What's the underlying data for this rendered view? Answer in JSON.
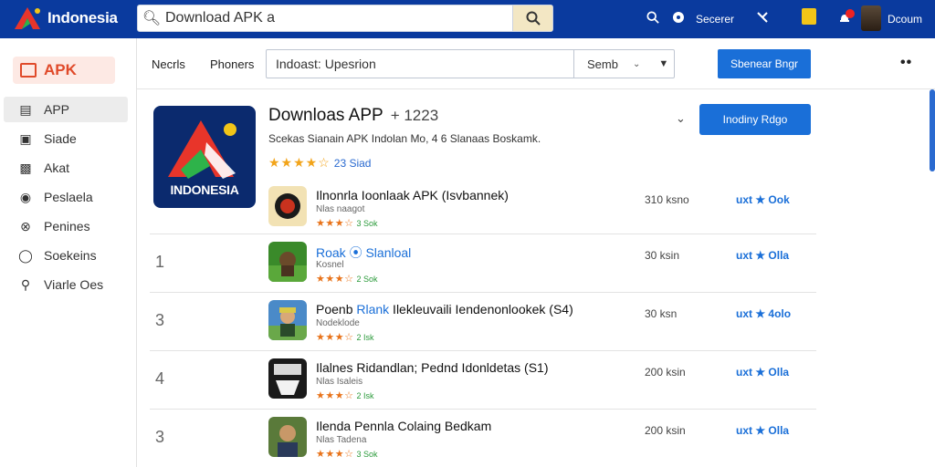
{
  "header": {
    "brand": "Indonesia",
    "search_value": "Download APK a",
    "account_label": "Secerer",
    "user_label": "Dcoum"
  },
  "sidebar": {
    "apk_label": "APK",
    "items": [
      {
        "label": "APP",
        "icon": "list-icon",
        "active": true
      },
      {
        "label": "Siade",
        "icon": "bag-icon",
        "active": false
      },
      {
        "label": "Akat",
        "icon": "chart-icon",
        "active": false
      },
      {
        "label": "Peslaela",
        "icon": "user-icon",
        "active": false
      },
      {
        "label": "Penines",
        "icon": "globe-icon",
        "active": false
      },
      {
        "label": "Soekeins",
        "icon": "settings-icon",
        "active": false
      },
      {
        "label": "Viarle Oes",
        "icon": "pin-icon",
        "active": false
      }
    ]
  },
  "toolbar": {
    "tab1": "Necrls",
    "tab2": "Phoners",
    "filter_text": "Indoast: Upesrion",
    "select_value": "Semb",
    "action_button": "Sbenear Bngr"
  },
  "featured": {
    "icon_text": "INDONESIA",
    "title": "Downloas APP",
    "version": "+ 1223",
    "description": "Scekas Sianain APK  Indolan  Mo,  4 6  Slanaas Boskamk.",
    "stars": "★★★★☆",
    "rating_count": "23 Siad",
    "button": "Inodiny Rdgo"
  },
  "list": [
    {
      "num": "",
      "title_a": "Ilnonrla Ioonlaak APK (Isvbannek)",
      "title_hl": "",
      "sub": "Nlas naagot",
      "stars": "★★★☆",
      "count": "3 Sok",
      "size": "310 ksno",
      "rate": "uxt ★ Ook",
      "icon_bg": "#f2e2b4"
    },
    {
      "num": "1",
      "title_a": "",
      "title_hl": "Roak ⦿ Slanloal",
      "sub": "Kosnel",
      "stars": "★★★☆",
      "count": "2 Sok",
      "size": "30  ksin",
      "rate": "uxt ★ Olla",
      "icon_bg": "#3a8a2a"
    },
    {
      "num": "3",
      "title_a": "Poenb ",
      "title_hl": "Rlank",
      "title_b": " Ilekleuvaili  Iendenonlookek (S4)",
      "sub": "Nodeklode",
      "stars": "★★★☆",
      "count": "2 Isk",
      "size": "30   ksn",
      "rate": "uxt ★ 4olo",
      "icon_bg": "#4a8ac8"
    },
    {
      "num": "4",
      "title_a": "Ilalnes Ridandlan; Pednd Idonldetas (S1)",
      "title_hl": "",
      "sub": "Nlas Isaleis",
      "stars": "★★★☆",
      "count": "2 Isk",
      "size": "200 ksin",
      "rate": "uxt ★ Olla",
      "icon_bg": "#1a1a1a"
    },
    {
      "num": "3",
      "title_a": "Ilenda Pennla Colaing Bedkam",
      "title_hl": "",
      "sub": "Nlas Tadena",
      "stars": "★★★☆",
      "count": "3 Sok",
      "size": "200 ksin",
      "rate": "uxt ★ Olla",
      "icon_bg": "#5a7a3a"
    }
  ],
  "colors": {
    "topbar": "#0a3a9e",
    "accent": "#1a6fd8",
    "apk_red": "#e04a2a",
    "star": "#f2a41a"
  }
}
